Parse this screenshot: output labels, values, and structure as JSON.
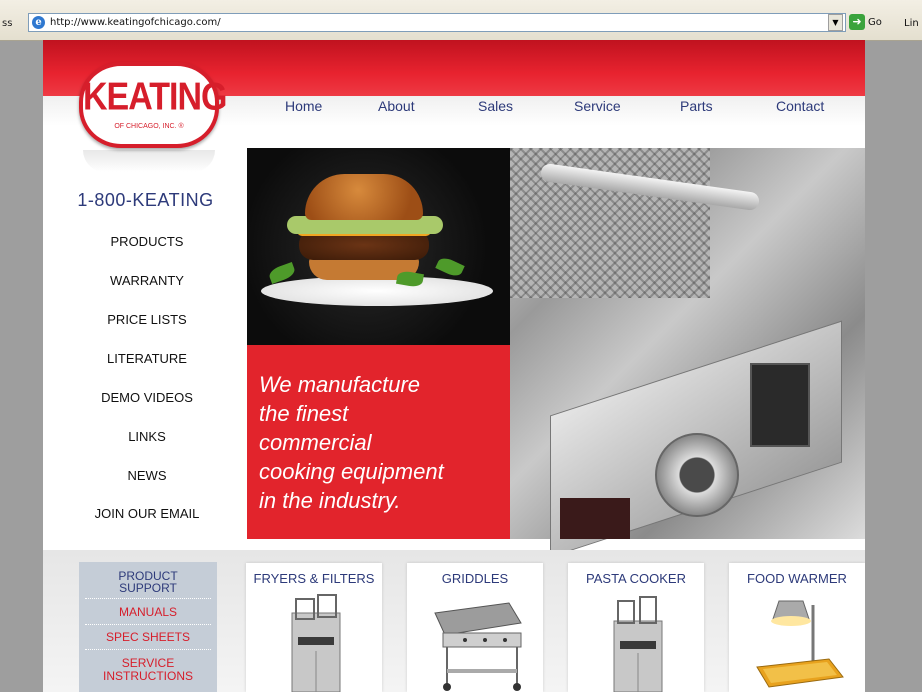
{
  "browser": {
    "address_label": "ss",
    "url": "http://www.keatingofchicago.com/",
    "go_label": "Go",
    "links_label": "Lin"
  },
  "logo": {
    "word": "KEATING",
    "sub": "OF CHICAGO, INC. ®"
  },
  "nav": {
    "items": [
      "Home",
      "About",
      "Sales",
      "Service",
      "Parts",
      "Contact"
    ]
  },
  "sidebar": {
    "phone": "1-800-KEATING",
    "links": [
      "PRODUCTS",
      "WARRANTY",
      "PRICE LISTS",
      "LITERATURE",
      "DEMO VIDEOS",
      "LINKS",
      "NEWS",
      "JOIN OUR EMAIL"
    ]
  },
  "hero": {
    "tagline_lines": [
      "We manufacture",
      "the finest",
      "commercial",
      "cooking equipment",
      "in the industry."
    ]
  },
  "support": {
    "heading_lines": [
      "PRODUCT",
      "SUPPORT"
    ],
    "items": [
      "MANUALS",
      "SPEC SHEETS"
    ],
    "service_lines": [
      "SERVICE",
      "INSTRUCTIONS"
    ]
  },
  "products": [
    "FRYERS & FILTERS",
    "GRIDDLES",
    "PASTA COOKER",
    "FOOD WARMER"
  ],
  "colors": {
    "brand_red": "#e2242c",
    "nav_blue": "#2d3a7a",
    "support_bg": "#c5cdd7"
  }
}
